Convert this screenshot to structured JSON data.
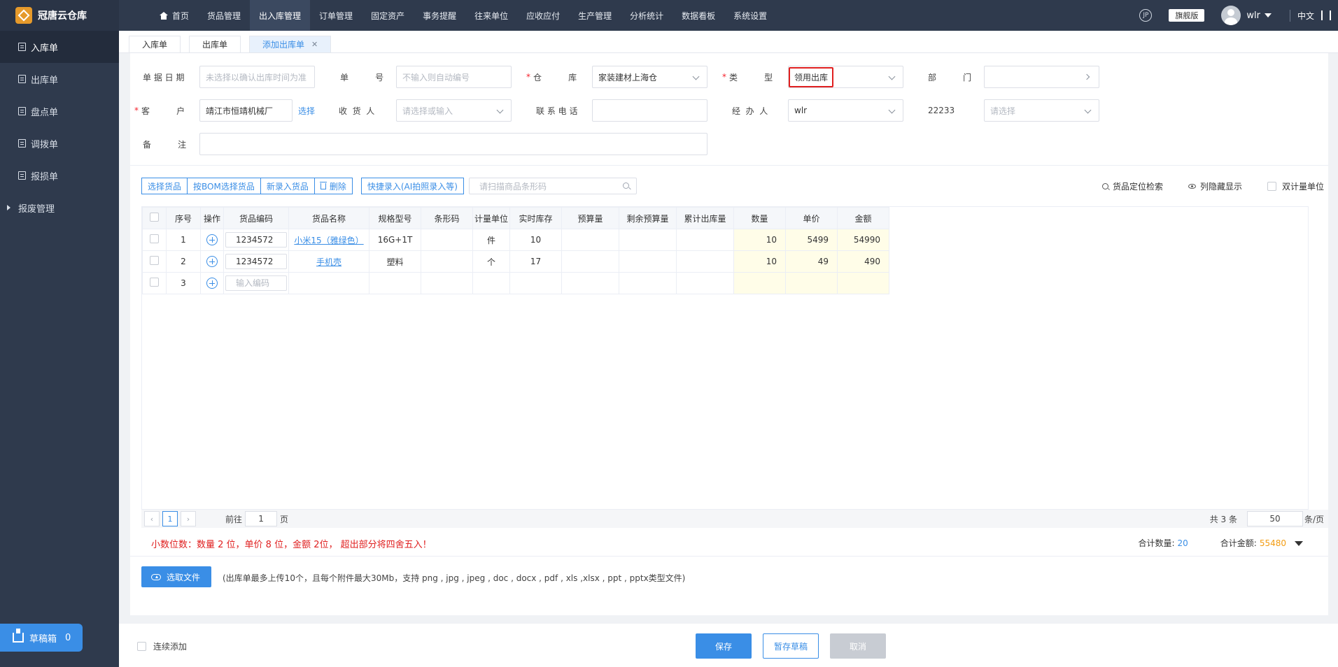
{
  "app": {
    "name": "冠唐云仓库"
  },
  "topnav": [
    {
      "label": "首页",
      "active": false
    },
    {
      "label": "货品管理",
      "active": false
    },
    {
      "label": "出入库管理",
      "active": true
    },
    {
      "label": "订单管理",
      "active": false
    },
    {
      "label": "固定资产",
      "active": false
    },
    {
      "label": "事务提醒",
      "active": false
    },
    {
      "label": "往来单位",
      "active": false
    },
    {
      "label": "应收应付",
      "active": false
    },
    {
      "label": "生产管理",
      "active": false
    },
    {
      "label": "分析统计",
      "active": false
    },
    {
      "label": "数据看板",
      "active": false
    },
    {
      "label": "系统设置",
      "active": false
    }
  ],
  "topright": {
    "help_glyph": "JP",
    "edition": "旗舰版",
    "username": "wlr",
    "language": "中文"
  },
  "sidebar": {
    "items": [
      {
        "label": "入库单"
      },
      {
        "label": "出库单"
      },
      {
        "label": "盘点单"
      },
      {
        "label": "调拨单"
      },
      {
        "label": "报损单"
      },
      {
        "label": "报废管理"
      }
    ],
    "draft_label": "草稿箱",
    "draft_count": "0"
  },
  "tabs": [
    {
      "label": "入库单"
    },
    {
      "label": "出库单"
    },
    {
      "label": "添加出库单"
    }
  ],
  "form": {
    "date_label": "单 据 日 期",
    "date_placeholder": "未选择以确认出库时间为准",
    "no_label": "单          号",
    "no_placeholder": "不输入则自动编号",
    "warehouse_label": "仓          库",
    "warehouse_value": "家装建材上海仓",
    "type_label": "类          型",
    "type_value": "领用出库",
    "dept_label": "部          门",
    "customer_label": "客          户",
    "customer_value": "靖江市恒靖机械厂",
    "customer_select": "选择",
    "receiver_label": "收  货  人",
    "receiver_placeholder": "请选择或输入",
    "phone_label": "联 系 电 话",
    "handler_label": "经  办  人",
    "handler_value": "wlr",
    "custom_label": "22233",
    "custom_placeholder": "请选择",
    "remark_label": "备          注"
  },
  "toolbar": {
    "select_goods": "选择货品",
    "bom_select": "按BOM选择货品",
    "new_goods": "新录入货品",
    "delete": "删除",
    "quick_entry": "快捷录入(AI拍照录入等)",
    "scan_placeholder": "请扫描商品条形码",
    "locate": "货品定位检索",
    "column_toggle": "列隐藏显示",
    "dual_unit": "双计量单位"
  },
  "table": {
    "headers": [
      "序号",
      "操作",
      "货品编码",
      "货品名称",
      "规格型号",
      "条形码",
      "计量单位",
      "实时库存",
      "预算量",
      "剩余预算量",
      "累计出库量",
      "数量",
      "单价",
      "金额"
    ],
    "rows": [
      {
        "seq": "1",
        "code": "1234572",
        "name": "小米15（雅绿色）",
        "spec": "16G+1T",
        "barcode": "",
        "unit": "件",
        "stock": "10",
        "budget": "",
        "remain": "",
        "cum": "",
        "qty": "10",
        "price": "5499",
        "amount": "54990"
      },
      {
        "seq": "2",
        "code": "1234572",
        "name": "手机壳",
        "spec": "塑料",
        "barcode": "",
        "unit": "个",
        "stock": "17",
        "budget": "",
        "remain": "",
        "cum": "",
        "qty": "10",
        "price": "49",
        "amount": "490"
      }
    ],
    "empty_row_seq": "3",
    "empty_code_placeholder": "输入编码"
  },
  "pager": {
    "current": "1",
    "goto_prefix": "前往",
    "goto_value": "1",
    "goto_suffix": "页",
    "total": "共 3 条",
    "page_size": "50",
    "per_page": "条/页"
  },
  "summary": {
    "precision_note": "小数位数：数量 2 位，单价 8 位，金额 2位， 超出部分将四舍五入！",
    "total_qty_label": "合计数量:",
    "total_qty": "20",
    "total_amount_label": "合计金额:",
    "total_amount": "55480"
  },
  "upload": {
    "button": "选取文件",
    "hint": "(出库单最多上传10个，且每个附件最大30Mb，支持 png , jpg , jpeg , doc , docx , pdf , xls ,xlsx , ppt , pptx类型文件)"
  },
  "footer": {
    "continuous_add": "连续添加",
    "save": "保存",
    "draft": "暂存草稿",
    "cancel": "取消"
  }
}
